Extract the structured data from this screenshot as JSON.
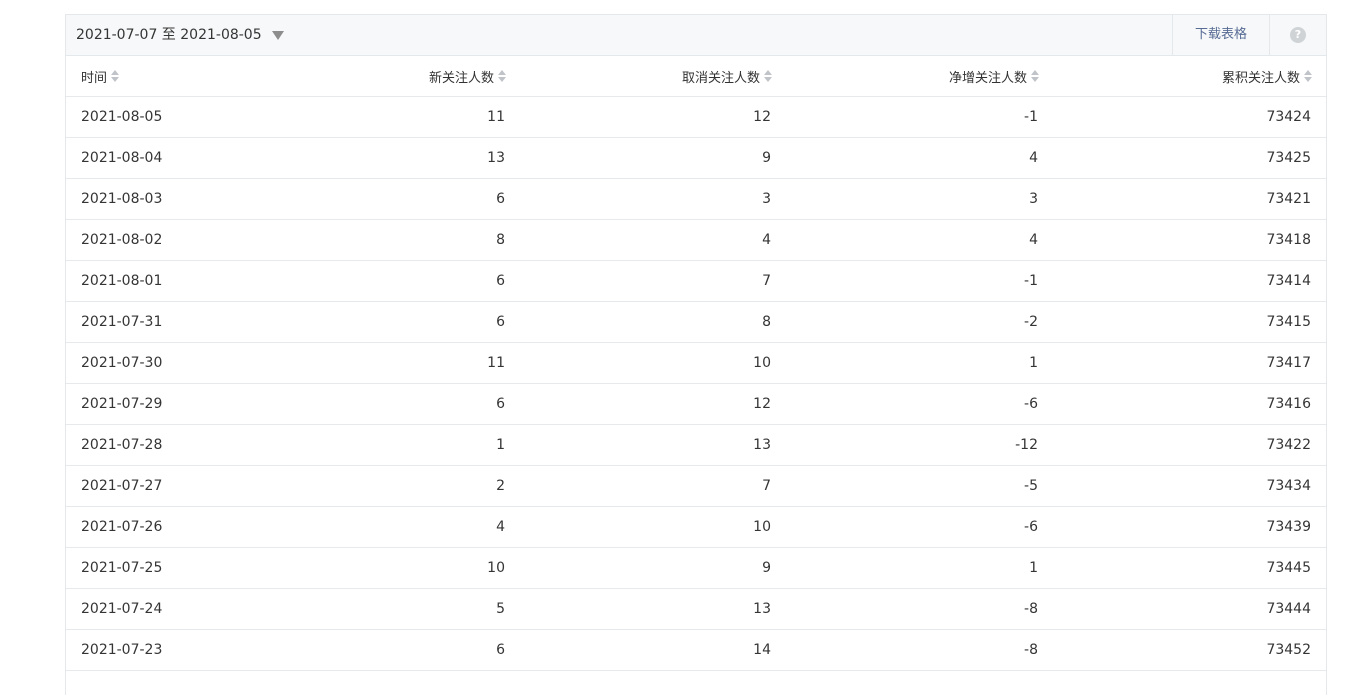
{
  "toolbar": {
    "date_range": "2021-07-07 至 2021-08-05",
    "download_label": "下载表格",
    "help_icon": "?"
  },
  "table": {
    "headers": [
      "时间",
      "新关注人数",
      "取消关注人数",
      "净增关注人数",
      "累积关注人数"
    ],
    "rows": [
      [
        "2021-08-05",
        "11",
        "12",
        "-1",
        "73424"
      ],
      [
        "2021-08-04",
        "13",
        "9",
        "4",
        "73425"
      ],
      [
        "2021-08-03",
        "6",
        "3",
        "3",
        "73421"
      ],
      [
        "2021-08-02",
        "8",
        "4",
        "4",
        "73418"
      ],
      [
        "2021-08-01",
        "6",
        "7",
        "-1",
        "73414"
      ],
      [
        "2021-07-31",
        "6",
        "8",
        "-2",
        "73415"
      ],
      [
        "2021-07-30",
        "11",
        "10",
        "1",
        "73417"
      ],
      [
        "2021-07-29",
        "6",
        "12",
        "-6",
        "73416"
      ],
      [
        "2021-07-28",
        "1",
        "13",
        "-12",
        "73422"
      ],
      [
        "2021-07-27",
        "2",
        "7",
        "-5",
        "73434"
      ],
      [
        "2021-07-26",
        "4",
        "10",
        "-6",
        "73439"
      ],
      [
        "2021-07-25",
        "10",
        "9",
        "1",
        "73445"
      ],
      [
        "2021-07-24",
        "5",
        "13",
        "-8",
        "73444"
      ],
      [
        "2021-07-23",
        "6",
        "14",
        "-8",
        "73452"
      ]
    ]
  },
  "colors": {
    "toolbar_bg": "#f6f8f9",
    "link": "#576b95",
    "border": "#e4e8eb"
  }
}
